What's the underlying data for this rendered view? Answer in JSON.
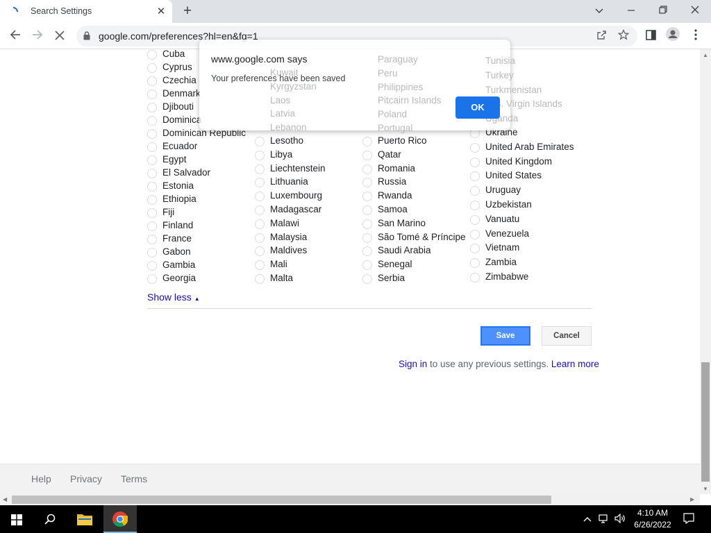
{
  "browser": {
    "tab_title": "Search Settings",
    "url": "google.com/preferences?hl=en&fg=1"
  },
  "countries": {
    "col1": [
      "Cuba",
      "Cyprus",
      "Czechia",
      "Denmark",
      "Djibouti",
      "Dominica",
      "Dominican Republic",
      "Ecuador",
      "Egypt",
      "El Salvador",
      "Estonia",
      "Ethiopia",
      "Fiji",
      "Finland",
      "France",
      "Gabon",
      "Gambia",
      "Georgia"
    ],
    "col2": [
      "Lesotho",
      "Libya",
      "Liechtenstein",
      "Lithuania",
      "Luxembourg",
      "Madagascar",
      "Malawi",
      "Malaysia",
      "Maldives",
      "Mali",
      "Malta"
    ],
    "col3": [
      "Puerto Rico",
      "Qatar",
      "Romania",
      "Russia",
      "Rwanda",
      "Samoa",
      "San Marino",
      "São Tomé & Príncipe",
      "Saudi Arabia",
      "Senegal",
      "Serbia"
    ],
    "col4": [
      "Ukraine",
      "United Arab Emirates",
      "United Kingdom",
      "United States",
      "Uruguay",
      "Uzbekistan",
      "Vanuatu",
      "Venezuela",
      "Vietnam",
      "Zambia",
      "Zimbabwe"
    ]
  },
  "covered": {
    "col2": [
      "Kuwait",
      "Kyrgyzstan",
      "Laos",
      "Latvia",
      "Lebanon"
    ],
    "col3": [
      "Paraguay",
      "Peru",
      "Philippines",
      "Pitcairn Islands",
      "Poland",
      "Portugal"
    ],
    "col4": [
      "Tunisia",
      "Turkey",
      "Turkmenistan",
      "U.S. Virgin Islands",
      "Uganda"
    ]
  },
  "settings": {
    "show_less": "Show less",
    "save_label": "Save",
    "cancel_label": "Cancel",
    "signin_link": "Sign in",
    "signin_text": " to use any previous settings. ",
    "learn_more": "Learn more"
  },
  "footer": {
    "help": "Help",
    "privacy": "Privacy",
    "terms": "Terms"
  },
  "dialog": {
    "title": "www.google.com says",
    "message": "Your preferences have been saved",
    "ok_label": "OK"
  },
  "taskbar": {
    "time": "4:10 AM",
    "date": "6/26/2022"
  }
}
